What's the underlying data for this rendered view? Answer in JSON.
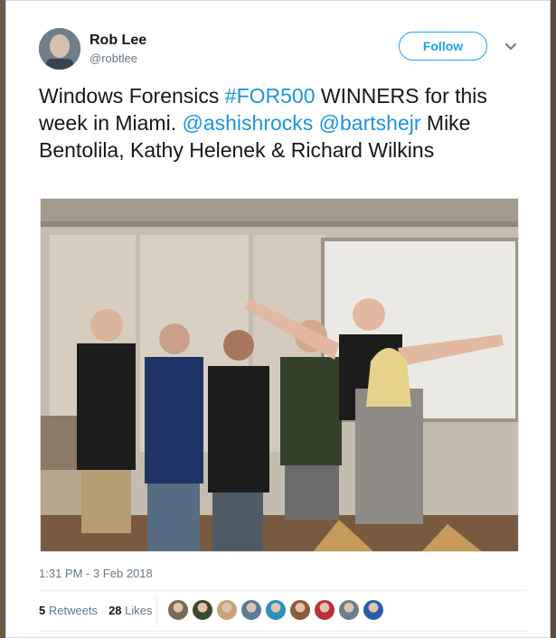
{
  "tweet": {
    "author_name": "Rob Lee",
    "author_handle": "@robtlee",
    "follow_label": "Follow",
    "text_parts": [
      {
        "text": "Windows Forensics ",
        "link": false
      },
      {
        "text": "#FOR500",
        "link": true
      },
      {
        "text": " WINNERS for this week in Miami. ",
        "link": false
      },
      {
        "text": "@ashishrocks",
        "link": true
      },
      {
        "text": " ",
        "link": false
      },
      {
        "text": "@bartshejr",
        "link": true
      },
      {
        "text": " Mike Bentolila, Kathy Helenek & Richard Wilkins",
        "link": false
      }
    ],
    "timestamp": "1:31 PM - 3 Feb 2018",
    "retweets_count": "5",
    "retweets_label": "Retweets",
    "likes_count": "28",
    "likes_label": "Likes",
    "liker_avatar_colors": [
      "#7b6a55",
      "#3a4a2f",
      "#c9a27a",
      "#5a7c9a",
      "#2e8fb8",
      "#8c5a3c",
      "#b8323a",
      "#6d7f8a",
      "#2a5fa8"
    ]
  },
  "colors": {
    "accent": "#1da1f2",
    "link": "#1b95e0",
    "text": "#14171a",
    "secondary": "#657786"
  },
  "icons": {
    "more": "chevron-down-icon"
  }
}
